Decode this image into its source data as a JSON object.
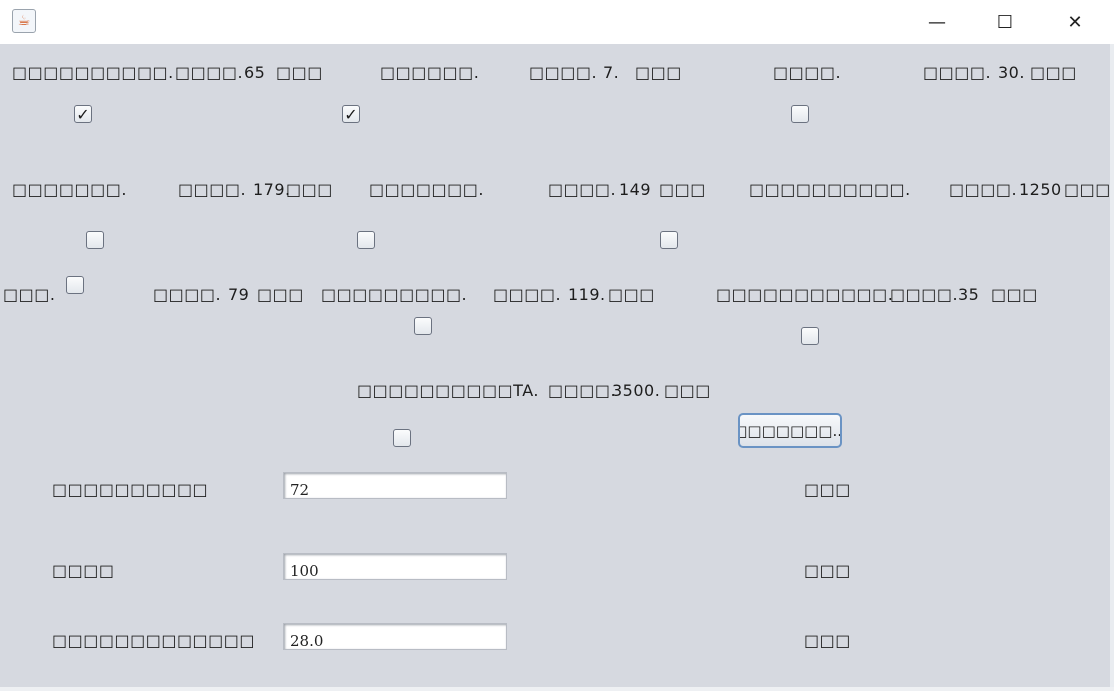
{
  "window": {
    "icon": "java-cup-icon",
    "minimize": "—",
    "maximize": "☐",
    "close": "✕"
  },
  "items": [
    {
      "name": "□□□□□□□□□□.",
      "price_label": "□□□□.",
      "price": "65",
      "unit": "□□□",
      "checked": true
    },
    {
      "name": "□□□□□□.",
      "price_label": "□□□□.",
      "price": "7.",
      "unit": "□□□",
      "checked": true
    },
    {
      "name": "□□□□.",
      "price_label": "□□□□.",
      "price": "30.",
      "unit": "□□□",
      "checked": false
    },
    {
      "name": "□□□□□□□.",
      "price_label": "□□□□.",
      "price": "179.",
      "unit": "□□□",
      "checked": false
    },
    {
      "name": "□□□□□□□.",
      "price_label": "□□□□.",
      "price": "149",
      "unit": "□□□",
      "checked": false
    },
    {
      "name": "□□□□□□□□□□.",
      "price_label": "□□□□.",
      "price": "1250",
      "unit": "□□□",
      "checked": false
    },
    {
      "name": "□□□.",
      "price_label": "□□□□.",
      "price": "79",
      "unit": "□□□",
      "checked": false
    },
    {
      "name": "□□□□□□□□□.",
      "price_label": "□□□□.",
      "price": "119.",
      "unit": "□□□",
      "checked": false
    },
    {
      "name": "□□□□□□□□□□□.",
      "price_label": "□□□□.",
      "price": "35",
      "unit": "□□□",
      "checked": false
    },
    {
      "name": "□□□□□□□□□□TA.",
      "price_label": "□□□□.",
      "price": "3500.",
      "unit": "□□□",
      "checked": false
    }
  ],
  "calculate_button": "□□□□□□□...",
  "fields": [
    {
      "label": "□□□□□□□□□□",
      "value": "72",
      "unit": "□□□"
    },
    {
      "label": "□□□□",
      "value": "100",
      "unit": "□□□"
    },
    {
      "label": "□□□□□□□□□□□□□",
      "value": "28.0",
      "unit": "□□□"
    }
  ]
}
